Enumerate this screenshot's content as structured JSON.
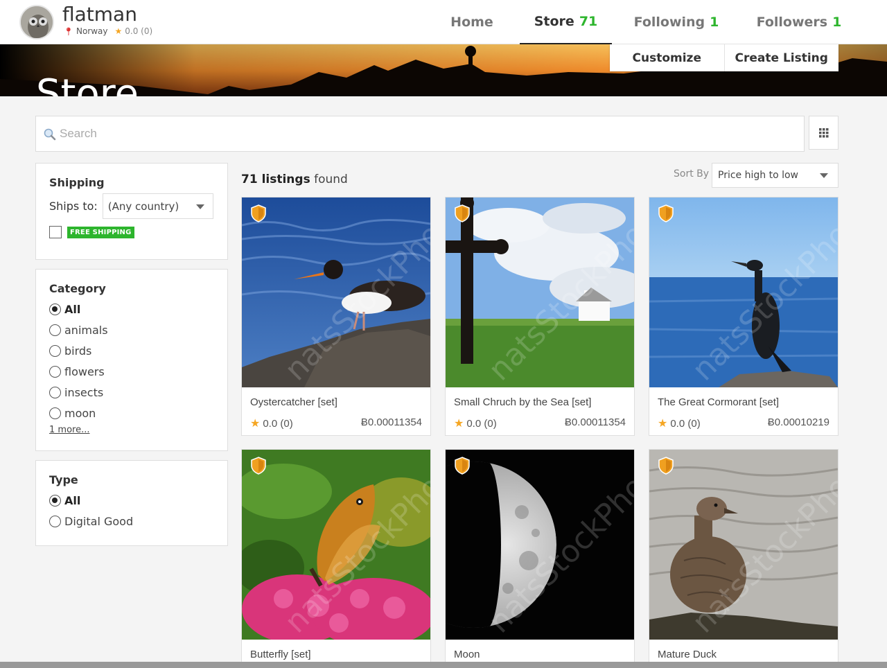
{
  "profile": {
    "name": "flatman",
    "location": "Norway",
    "rating": "0.0 (0)"
  },
  "nav": {
    "home": "Home",
    "store": "Store",
    "store_count": "71",
    "following": "Following",
    "following_count": "1",
    "followers": "Followers",
    "followers_count": "1"
  },
  "banner": {
    "title": "Store",
    "customize": "Customize",
    "create_listing": "Create Listing"
  },
  "search": {
    "placeholder": "Search"
  },
  "filters": {
    "shipping": {
      "title": "Shipping",
      "ships_to_label": "Ships to:",
      "ships_to_value": "(Any country)",
      "free_shipping_badge": "FREE SHIPPING"
    },
    "category": {
      "title": "Category",
      "options": [
        "All",
        "animals",
        "birds",
        "flowers",
        "insects",
        "moon"
      ],
      "selected": "All",
      "more": "1 more..."
    },
    "type": {
      "title": "Type",
      "options": [
        "All",
        "Digital Good"
      ],
      "selected": "All"
    }
  },
  "listings": {
    "count": "71 listings",
    "found_suffix": "found",
    "sort_label": "Sort By",
    "sort_value": "Price high to low",
    "items": [
      {
        "title": "Oystercatcher [set]",
        "rating": "0.0 (0)",
        "price": "Ƀ0.00011354"
      },
      {
        "title": "Small Chruch by the Sea [set]",
        "rating": "0.0 (0)",
        "price": "Ƀ0.00011354"
      },
      {
        "title": "The Great Cormorant [set]",
        "rating": "0.0 (0)",
        "price": "Ƀ0.00010219"
      },
      {
        "title": "Butterfly [set]"
      },
      {
        "title": "Moon"
      },
      {
        "title": "Mature Duck"
      }
    ]
  },
  "colors": {
    "accent_green": "#2db52d",
    "star": "#f5a623",
    "shield": "#f0a020"
  }
}
